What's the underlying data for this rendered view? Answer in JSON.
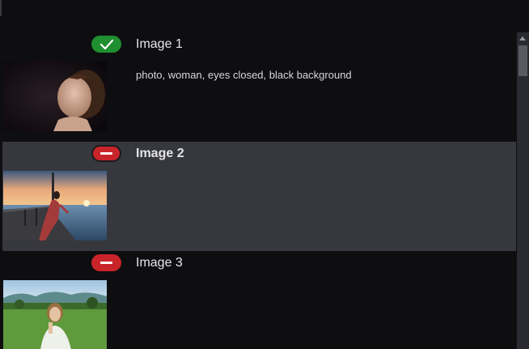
{
  "items": [
    {
      "title": "Image 1",
      "caption": "photo, woman, eyes closed, black background",
      "status_icon": "check-icon",
      "status_color": "#1f8f2f",
      "selected": false
    },
    {
      "title": "Image 2",
      "caption": "",
      "status_icon": "minus-icon",
      "status_color": "#c9242a",
      "selected": true
    },
    {
      "title": "Image 3",
      "caption": "",
      "status_icon": "minus-icon",
      "status_color": "#c9242a",
      "selected": false
    }
  ],
  "colors": {
    "background": "#0e0e11",
    "selected_row": "#36383e",
    "text": "#e8e8ea"
  }
}
